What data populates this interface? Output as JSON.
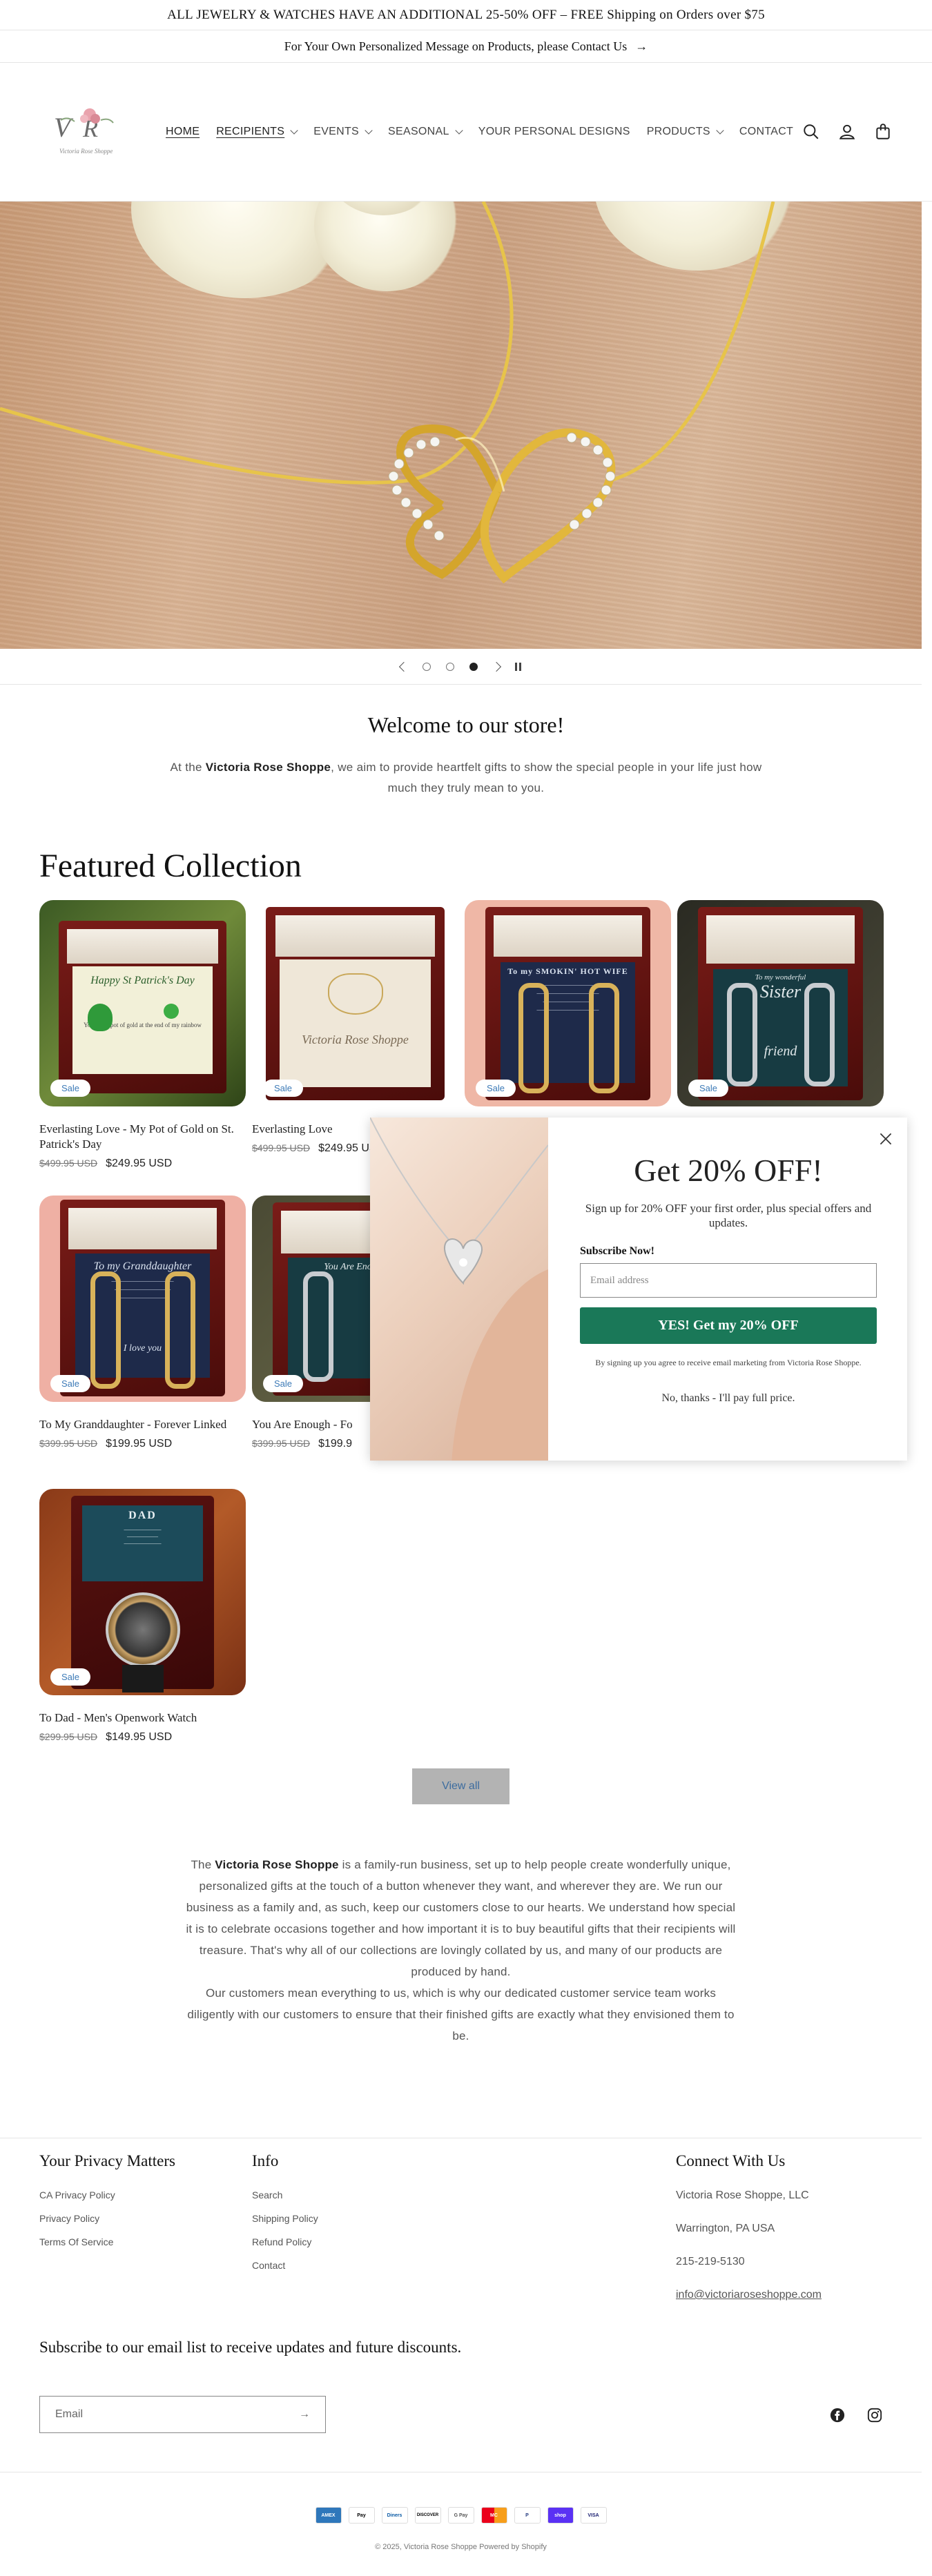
{
  "announcement": {
    "line1": "ALL JEWELRY & WATCHES HAVE AN ADDITIONAL 25-50% OFF – FREE Shipping on Orders over $75",
    "line2": "For Your Own Personalized Message on Products, please Contact Us"
  },
  "nav": {
    "items": [
      "HOME",
      "RECIPIENTS",
      "EVENTS",
      "SEASONAL",
      "YOUR PERSONAL DESIGNS",
      "PRODUCTS",
      "CONTACT"
    ]
  },
  "welcome": {
    "title": "Welcome to our store!",
    "text_prefix": "At the ",
    "brand": "Victoria Rose Shoppe",
    "text_suffix": ", we aim to provide heartfelt gifts to show the special people in your life just how much they truly mean to you."
  },
  "featured": {
    "title": "Featured Collection",
    "sale_label": "Sale",
    "products": [
      {
        "title": "Everlasting Love - My Pot of Gold on St. Patrick's Day",
        "old_price": "$499.95 USD",
        "price": "$249.95 USD"
      },
      {
        "title": "Everlasting Love",
        "old_price": "$499.95 USD",
        "price": "$249.95 USD"
      },
      {
        "title": "",
        "old_price": "",
        "price": ""
      },
      {
        "title": "",
        "old_price": "",
        "price": ""
      },
      {
        "title": "To My Granddaughter - Forever Linked",
        "old_price": "$399.95 USD",
        "price": "$199.95 USD"
      },
      {
        "title": "You Are Enough - Fo",
        "old_price": "$399.95 USD",
        "price": "$199.9"
      },
      {
        "title": "To Dad - Men's Openwork Watch",
        "old_price": "$299.95 USD",
        "price": "$149.95 USD"
      }
    ],
    "card_text": {
      "p1": "Happy St Patrick's Day",
      "p1b": "You're the pot of gold at the end of my rainbow",
      "p2": "Victoria Rose Shoppe",
      "p3": "To my SMOKIN' HOT WIFE",
      "p4a": "To my wonderful",
      "p4b": "Sister",
      "p4c": "friend",
      "p5": "To my Granddaughter",
      "p5b": "I love you",
      "p6": "You Are Enough",
      "p7": "DAD"
    },
    "view_all": "View all"
  },
  "about": {
    "p1_prefix": "The ",
    "brand": "Victoria Rose Shoppe",
    "p1_suffix": " is a family-run business, set up to help people create wonderfully unique, personalized gifts at the touch of a button whenever they want, and wherever they are. We run our business as a family and, as such, keep our customers close to our hearts. We understand how special it is to celebrate occasions together and how important it is to buy beautiful gifts that their recipients will treasure. That's why all of our collections are lovingly collated by us, and many of our products are produced by hand.",
    "p2": "Our customers mean everything to us, which is why our dedicated customer service team works diligently with our customers to ensure that their finished gifts are exactly what they envisioned them to be."
  },
  "footer": {
    "privacy": {
      "title": "Your Privacy Matters",
      "links": [
        "CA Privacy Policy",
        "Privacy Policy",
        "Terms Of Service"
      ]
    },
    "info": {
      "title": "Info",
      "links": [
        "Search",
        "Shipping Policy",
        "Refund Policy",
        "Contact"
      ]
    },
    "connect": {
      "title": "Connect With Us",
      "company": "Victoria Rose Shoppe, LLC",
      "location": "Warrington, PA USA",
      "phone": "215-219-5130",
      "email": "info@victoriaroseshoppe.com"
    },
    "subscribe_title": "Subscribe to our email list to receive updates and future discounts.",
    "email_placeholder": "Email",
    "payments": [
      "AMEX",
      "Pay",
      "Diners",
      "DISCOVER",
      "G Pay",
      "MC",
      "P",
      "shop",
      "VISA"
    ],
    "copyright": "© 2025, Victoria Rose Shoppe Powered by Shopify"
  },
  "popup": {
    "title": "Get 20% OFF!",
    "subtitle": "Sign up for 20% OFF your first order, plus special offers and updates.",
    "label": "Subscribe Now!",
    "email_placeholder": "Email address",
    "button": "YES! Get my 20% OFF",
    "legal": "By signing up you agree to receive email marketing from Victoria Rose Shoppe.",
    "decline": "No, thanks - I'll pay full price."
  },
  "colors": {
    "popup_button": "#1a7858",
    "sale_text": "#3c7ab7",
    "view_all_bg": "#b3b3b3"
  }
}
